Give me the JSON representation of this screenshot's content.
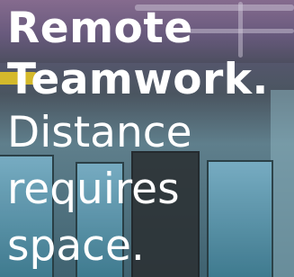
{
  "hero": {
    "headline_lines": [
      "Remote",
      "Teamwork."
    ],
    "tagline_lines": [
      "Distance",
      "requires",
      "space."
    ]
  },
  "colors": {
    "text": "#ffffff",
    "accent_yellow": "#e3c425"
  }
}
